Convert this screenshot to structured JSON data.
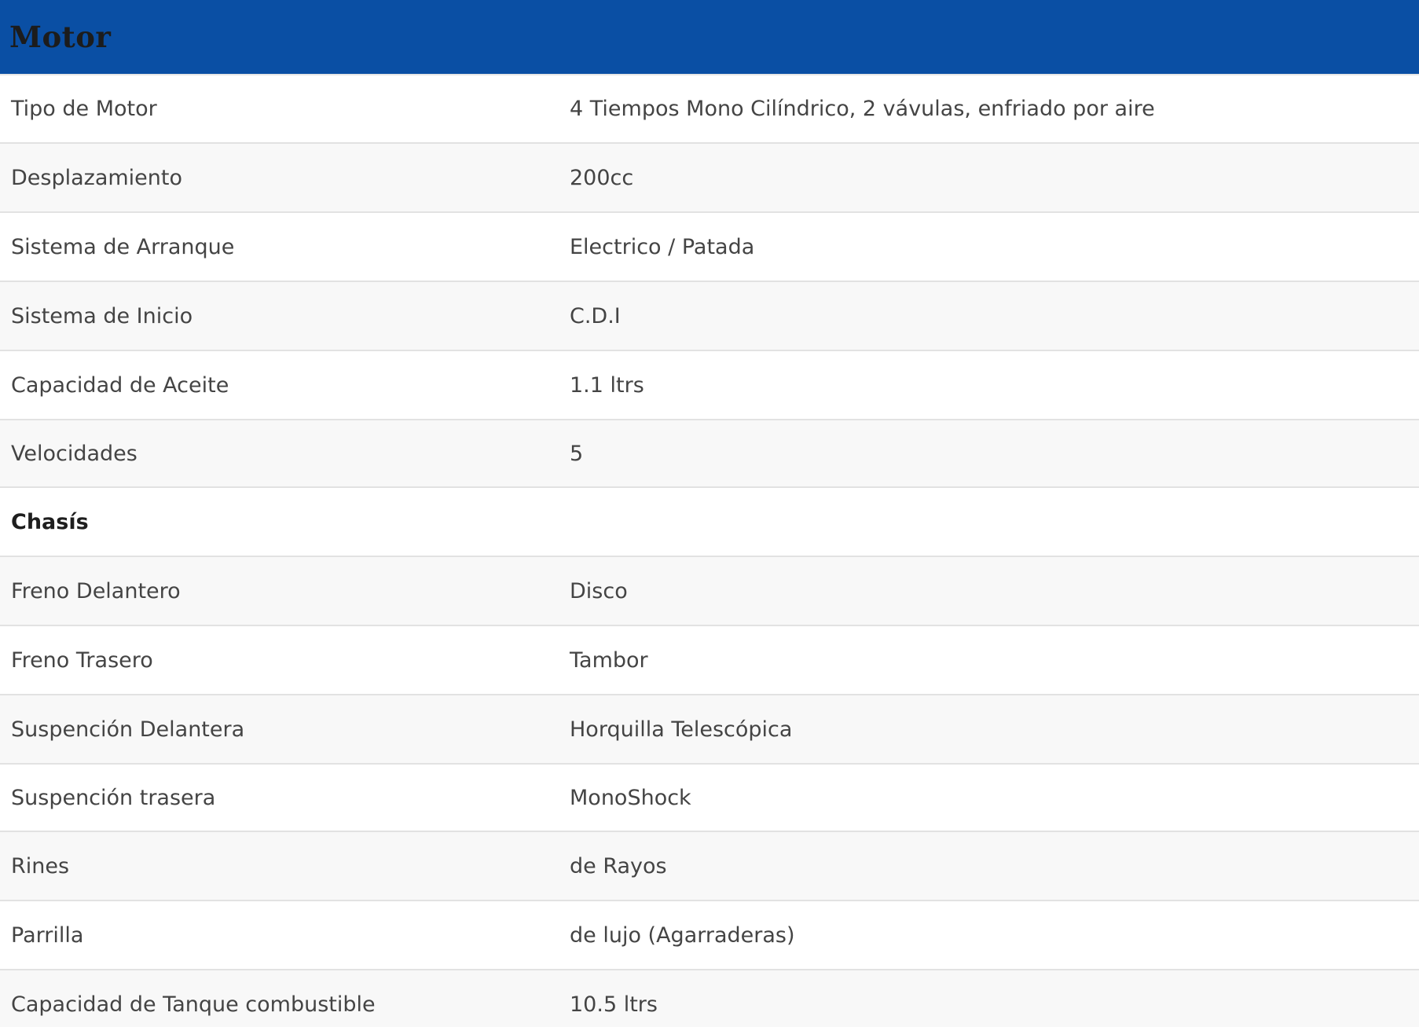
{
  "header": {
    "title": "Motor"
  },
  "rows": [
    {
      "label": "Tipo de Motor",
      "value": "4 Tiempos Mono Cilíndrico, 2 vávulas, enfriado por aire"
    },
    {
      "label": "Desplazamiento",
      "value": "200cc"
    },
    {
      "label": "Sistema de Arranque",
      "value": "Electrico / Patada"
    },
    {
      "label": "Sistema de Inicio",
      "value": "C.D.I"
    },
    {
      "label": "Capacidad de Aceite",
      "value": "1.1 ltrs"
    },
    {
      "label": "Velocidades",
      "value": "5"
    },
    {
      "label": "Chasís",
      "value": ""
    },
    {
      "label": "Freno Delantero",
      "value": "Disco"
    },
    {
      "label": "Freno Trasero",
      "value": "Tambor"
    },
    {
      "label": "Suspención Delantera",
      "value": "Horquilla Telescópica"
    },
    {
      "label": "Suspención trasera",
      "value": "MonoShock"
    },
    {
      "label": "Rines",
      "value": "de Rayos"
    },
    {
      "label": "Parrilla",
      "value": "de lujo (Agarraderas)"
    },
    {
      "label": "Capacidad de Tanque combustible",
      "value": "10.5 ltrs"
    }
  ]
}
